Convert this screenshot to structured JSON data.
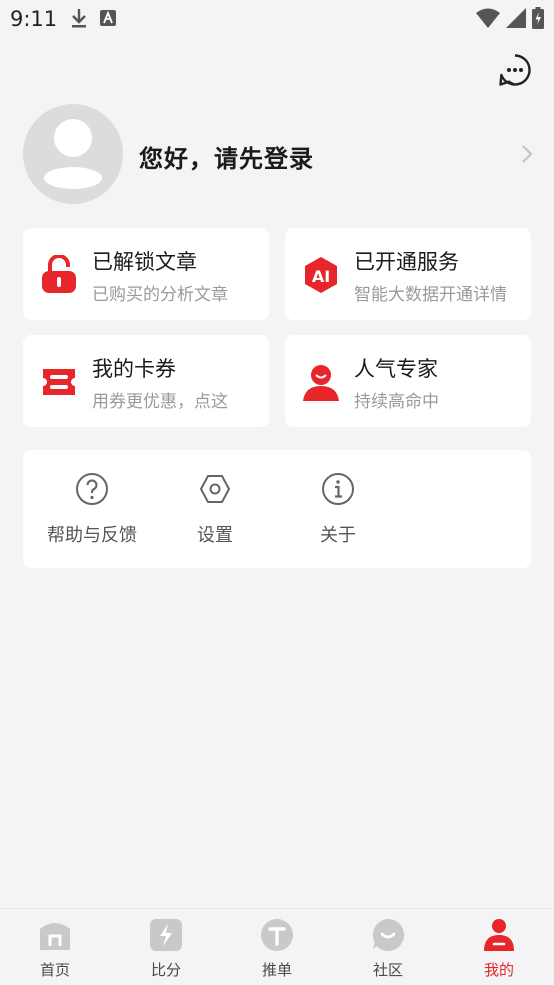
{
  "status_bar": {
    "time": "9:11"
  },
  "profile": {
    "login_prompt": "您好，请先登录"
  },
  "cards": [
    {
      "title": "已解锁文章",
      "subtitle": "已购买的分析文章",
      "icon": "unlock-icon"
    },
    {
      "title": "已开通服务",
      "subtitle": "智能大数据开通详情",
      "icon": "ai-badge-icon",
      "badge_text": "AI"
    },
    {
      "title": "我的卡券",
      "subtitle": "用券更优惠，点这",
      "icon": "ticket-icon"
    },
    {
      "title": "人气专家",
      "subtitle": "持续高命中",
      "icon": "expert-icon"
    }
  ],
  "tools": [
    {
      "label": "帮助与反馈",
      "icon": "help-icon"
    },
    {
      "label": "设置",
      "icon": "settings-icon"
    },
    {
      "label": "关于",
      "icon": "info-icon"
    }
  ],
  "tabs": [
    {
      "label": "首页",
      "icon": "home-icon",
      "active": false
    },
    {
      "label": "比分",
      "icon": "score-icon",
      "active": false
    },
    {
      "label": "推单",
      "icon": "recommend-icon",
      "active": false
    },
    {
      "label": "社区",
      "icon": "community-icon",
      "active": false
    },
    {
      "label": "我的",
      "icon": "profile-icon",
      "active": true
    }
  ],
  "colors": {
    "accent": "#e6262a",
    "background": "#f4f4f6",
    "card": "#ffffff",
    "inactive_icon": "#c9c9c9"
  }
}
